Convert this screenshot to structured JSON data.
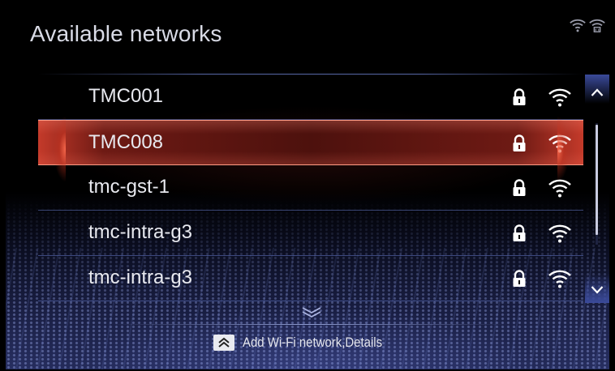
{
  "header": {
    "title": "Available networks",
    "status_icons": [
      "wifi-status-icon",
      "wifi-hotspot-icon"
    ]
  },
  "networks": [
    {
      "name": "TMC001",
      "locked": true,
      "signal": "full",
      "selected": false
    },
    {
      "name": "TMC008",
      "locked": true,
      "signal": "full",
      "selected": true
    },
    {
      "name": "tmc-gst-1",
      "locked": true,
      "signal": "full",
      "selected": false
    },
    {
      "name": "tmc-intra-g3",
      "locked": true,
      "signal": "full",
      "selected": false
    },
    {
      "name": "tmc-intra-g3",
      "locked": true,
      "signal": "full",
      "selected": false
    }
  ],
  "scroll": {
    "up_icon": "chevron-up-icon",
    "down_icon": "chevron-down-icon"
  },
  "footer": {
    "text": "Add Wi-Fi network,Details",
    "icon": "double-chevron-up-icon"
  },
  "colors": {
    "selected_row": "#6e1a14",
    "selected_glow": "#ff6e50",
    "divider": "#6478c8",
    "text": "#e8e9ef"
  }
}
